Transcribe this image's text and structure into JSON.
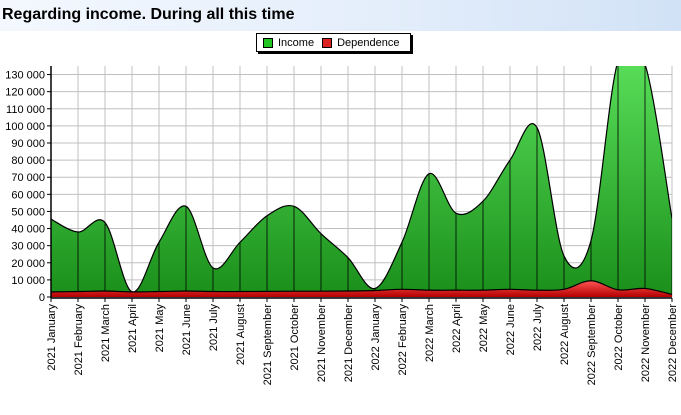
{
  "page": {
    "title": "Regarding income. During all this time"
  },
  "colors": {
    "income_fill_top": "#5ee55e",
    "income_fill_bottom": "#1a8f1a",
    "income_line": "#000000",
    "dependence_fill_top": "#ff5555",
    "dependence_fill_bottom": "#b40000",
    "grid": "#c0c0c0"
  },
  "legend": {
    "items": [
      {
        "label": "Income",
        "color": "#22c422"
      },
      {
        "label": "Dependence",
        "color": "#dd2222"
      }
    ]
  },
  "chart_data": {
    "type": "area",
    "title": "Regarding income. During all this time",
    "xlabel": "",
    "ylabel": "",
    "categories": [
      "2021 January",
      "2021 February",
      "2021 March",
      "2021 April",
      "2021 May",
      "2021 June",
      "2021 July",
      "2021 August",
      "2021 September",
      "2021 October",
      "2021 November",
      "2021 December",
      "2022 January",
      "2022 February",
      "2022 March",
      "2022 April",
      "2022 May",
      "2022 June",
      "2022 July",
      "2022 August",
      "2022 September",
      "2022 October",
      "2022 November",
      "2022 December"
    ],
    "series": [
      {
        "name": "Income",
        "values": [
          45500,
          38000,
          43500,
          3000,
          32000,
          53000,
          17000,
          32000,
          47500,
          53000,
          37000,
          23000,
          5000,
          32000,
          72000,
          49000,
          56000,
          80000,
          99000,
          24000,
          33000,
          138000,
          136000,
          46000
        ]
      },
      {
        "name": "Dependence",
        "values": [
          3000,
          3200,
          3500,
          3000,
          3200,
          3500,
          3200,
          3200,
          3300,
          3400,
          3400,
          3500,
          3800,
          4500,
          4000,
          4000,
          4000,
          4500,
          4000,
          4500,
          9500,
          4200,
          5000,
          1500
        ]
      }
    ],
    "ylim": [
      0,
      135000
    ],
    "yticks": [
      "0",
      "10 000",
      "20 000",
      "30 000",
      "40 000",
      "50 000",
      "60 000",
      "70 000",
      "80 000",
      "90 000",
      "100 000",
      "110 000",
      "120 000",
      "130 000"
    ],
    "grid": true,
    "legend_position": "top-center"
  }
}
